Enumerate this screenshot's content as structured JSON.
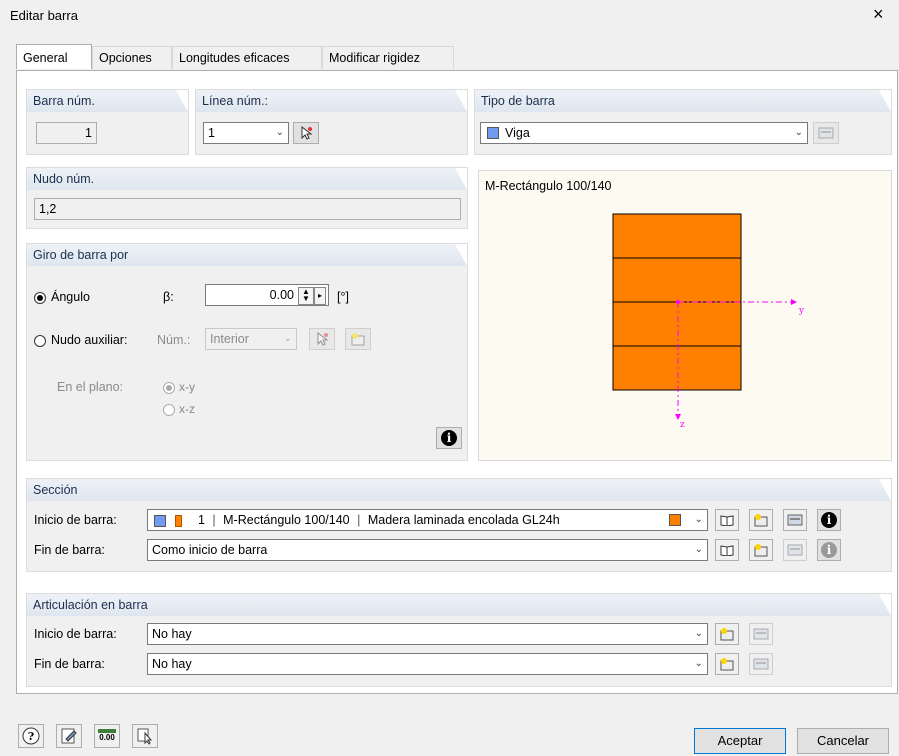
{
  "window": {
    "title": "Editar barra",
    "close_glyph": "×"
  },
  "tabs": [
    "General",
    "Opciones",
    "Longitudes eficaces",
    "Modificar rigidez"
  ],
  "barra": {
    "label": "Barra núm.",
    "value": "1"
  },
  "linea": {
    "label": "Línea núm.:",
    "value": "1"
  },
  "tipo": {
    "label": "Tipo de barra",
    "value": "Viga",
    "color": "#6f9cf0"
  },
  "nudo": {
    "label": "Nudo núm.",
    "value": "1,2"
  },
  "giro": {
    "label": "Giro de barra por",
    "angulo_label": "Ángulo",
    "beta_label": "β:",
    "beta_value": "0.00",
    "unit": "[°]",
    "nudo_aux_label": "Nudo auxiliar:",
    "num_label": "Núm.:",
    "num_value": "Interior",
    "plano_label": "En el plano:",
    "plano_options": [
      "x-y",
      "x-z"
    ]
  },
  "preview": {
    "title": "M-Rectángulo 100/140",
    "fill": "#ff8000",
    "axis_y": "y",
    "axis_z": "z",
    "axis_color": "#ff00ff"
  },
  "seccion": {
    "label": "Sección",
    "inicio_label": "Inicio de barra:",
    "inicio_num": "1",
    "inicio_name": "M-Rectángulo 100/140",
    "inicio_material": "Madera laminada encolada GL24h",
    "fin_label": "Fin de barra:",
    "fin_value": "Como inicio de barra",
    "color_blue": "#6f9cf0",
    "color_orange": "#ff8000"
  },
  "articulacion": {
    "label": "Articulación en barra",
    "inicio_label": "Inicio de barra:",
    "inicio_value": "No hay",
    "fin_label": "Fin de barra:",
    "fin_value": "No hay"
  },
  "footer": {
    "accept": "Aceptar",
    "cancel": "Cancelar",
    "numeric_icon_text": "0.00"
  }
}
